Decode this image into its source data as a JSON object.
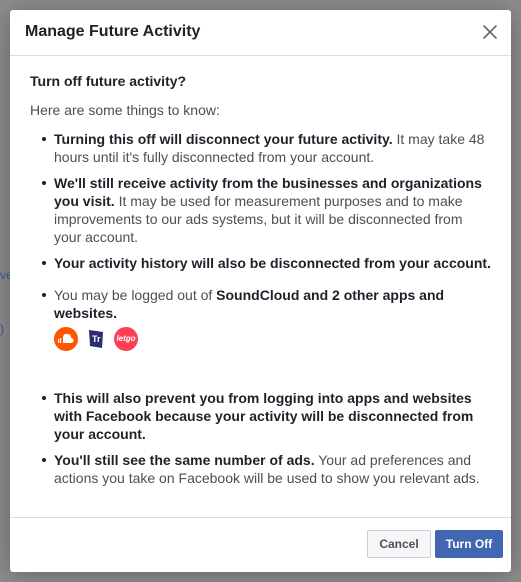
{
  "background": {
    "fragment_1": "ve",
    "fragment_2": ")"
  },
  "dialog": {
    "title": "Manage Future Activity",
    "heading": "Turn off future activity?",
    "intro": "Here are some things to know:",
    "items": [
      {
        "bold": "Turning this off will disconnect your future activity.",
        "text": " It may take 48 hours until it's fully disconnected from your account."
      },
      {
        "bold": "We'll still receive activity from the businesses and organizations you visit.",
        "text": " It may be used for measurement purposes and to make improvements to our ads systems, but it will be disconnected from your account."
      },
      {
        "bold": "Your activity history will also be disconnected from your account.",
        "text": ""
      },
      {
        "bold_lead": "You may be logged out of ",
        "bold": "SoundCloud and 2 other apps and websites."
      },
      {
        "bold": "This will also prevent you from logging into apps and websites with Facebook because your activity will be disconnected from your account.",
        "text": ""
      },
      {
        "bold": "You'll still see the same number of ads.",
        "text": " Your ad preferences and actions you take on Facebook will be used to show you relevant ads."
      }
    ],
    "apps": [
      {
        "icon": "soundcloud-icon",
        "color": "#ff5500"
      },
      {
        "icon": "trivago-icon",
        "color": "#2b2d6e"
      },
      {
        "icon": "letgo-icon",
        "color": "#ff3f55"
      }
    ],
    "apps_letgo_text": "letgo",
    "buttons": {
      "cancel": "Cancel",
      "turn_off": "Turn Off"
    },
    "colors": {
      "primary": "#4267b2"
    }
  }
}
